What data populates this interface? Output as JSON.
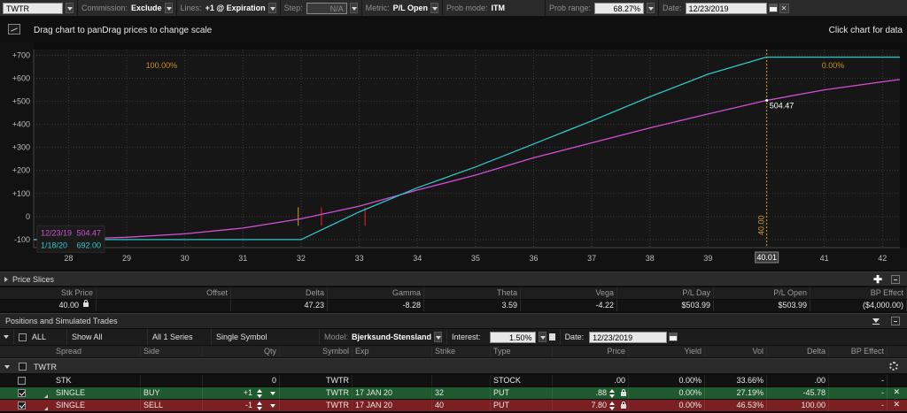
{
  "toolbar": {
    "symbol": "TWTR",
    "commission_label": "Commission:",
    "commission_value": "Exclude",
    "lines_label": "Lines:",
    "lines_value": "+1 @ Expiration",
    "step_label": "Step:",
    "step_value": "N/A",
    "metric_label": "Metric:",
    "metric_value": "P/L Open",
    "probmode_label": "Prob mode:",
    "probmode_value": "ITM",
    "probrange_label": "Prob range:",
    "probrange_value": "68.27%",
    "date_label": "Date:",
    "date_value": "12/23/2019"
  },
  "chart_header": {
    "drag_text": "Drag chart to panDrag prices to change scale",
    "click_text": "Click chart for data"
  },
  "chart_data": {
    "type": "line",
    "xlim": [
      27.4,
      42.3
    ],
    "ylim": [
      -135,
      725
    ],
    "x_ticks": [
      28,
      29,
      30,
      31,
      32,
      33,
      34,
      35,
      36,
      37,
      38,
      39,
      40,
      41,
      42
    ],
    "y_ticks": [
      700,
      600,
      500,
      400,
      300,
      200,
      100,
      0,
      -100
    ],
    "y_tick_labels": [
      "+700",
      "+600",
      "+500",
      "+400",
      "+300",
      "+200",
      "+100",
      "0",
      "-100"
    ],
    "series": [
      {
        "name": "12/23/19",
        "color": "#d24fd6",
        "x": [
          27.4,
          28,
          29,
          30,
          31,
          32,
          33,
          34,
          35,
          36,
          37,
          38,
          39,
          40,
          41,
          42,
          42.3
        ],
        "y": [
          -101,
          -98,
          -90,
          -75,
          -50,
          -10,
          45,
          115,
          180,
          255,
          320,
          385,
          445,
          504,
          550,
          585,
          595
        ]
      },
      {
        "name": "1/18/20",
        "color": "#2ec8c8",
        "x": [
          27.4,
          32,
          33,
          34,
          35,
          36,
          37,
          38,
          39,
          40,
          42.3
        ],
        "y": [
          -100,
          -100,
          20,
          125,
          215,
          315,
          415,
          520,
          618,
          692,
          692
        ]
      }
    ],
    "legend": [
      {
        "label": "12/23/19",
        "value": "504.47",
        "color": "#d24fd6"
      },
      {
        "label": "1/18/20",
        "value": "692.00",
        "color": "#2ec8c8"
      }
    ],
    "cursor_x": 40.01,
    "cursor_label": "40.01",
    "cursor_value_label": "504.47",
    "cursor_vertical_label": "40.00",
    "prob_left_label": "100.00%",
    "prob_right_label": "0.00%",
    "markers": [
      {
        "x": 32.35,
        "color": "#cc2222"
      },
      {
        "x": 33.1,
        "color": "#cc2222"
      },
      {
        "x": 31.95,
        "color": "#b08a1a"
      }
    ],
    "grid": true,
    "legend_position": "bottom-left"
  },
  "price_slices": {
    "title": "Price Slices",
    "headers": [
      "Stk Price",
      "Offset",
      "Delta",
      "Gamma",
      "Theta",
      "Vega",
      "P/L Day",
      "P/L Open",
      "BP Effect"
    ],
    "row": [
      "40.00",
      "",
      "47.23",
      "-8.28",
      "3.59",
      "-4.22",
      "$503.99",
      "$503.99",
      "($4,000.00)"
    ]
  },
  "positions": {
    "title": "Positions and Simulated Trades",
    "all_label": "ALL",
    "show_all": "Show All",
    "series": "All 1 Series",
    "symbol_mode": "Single Symbol",
    "model_label": "Model:",
    "model_value": "Bjerksund-Stensland",
    "interest_label": "Interest:",
    "interest_value": "1.50%",
    "date_label": "Date:",
    "date_value": "12/23/2019",
    "headers": [
      "Spread",
      "Side",
      "Qty",
      "Symbol",
      "Exp",
      "Strike",
      "Type",
      "Price",
      "Yield",
      "Vol",
      "Delta",
      "BP Effect"
    ],
    "group": "TWTR",
    "rows": [
      {
        "spread": "STK",
        "side": "",
        "qty": "0",
        "symbol": "TWTR",
        "exp": "",
        "strike": "",
        "type": "STOCK",
        "price": ".00",
        "yield": "0.00%",
        "vol": "33.66%",
        "delta": ".00",
        "bp": "-"
      },
      {
        "spread": "SINGLE",
        "side": "BUY",
        "qty": "+1",
        "symbol": "TWTR",
        "exp": "17 JAN 20",
        "strike": "32",
        "type": "PUT",
        "price": ".88",
        "yield": "0.00%",
        "vol": "27.19%",
        "delta": "-45.78",
        "bp": "-"
      },
      {
        "spread": "SINGLE",
        "side": "SELL",
        "qty": "-1",
        "symbol": "TWTR",
        "exp": "17 JAN 20",
        "strike": "40",
        "type": "PUT",
        "price": "7.80",
        "yield": "0.00%",
        "vol": "46.53%",
        "delta": "100.00",
        "bp": "-"
      }
    ]
  }
}
